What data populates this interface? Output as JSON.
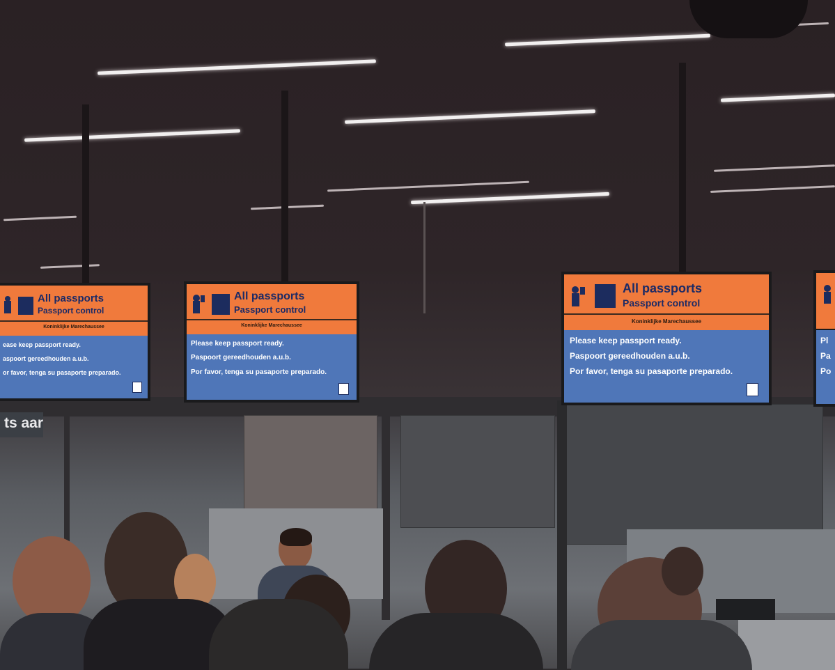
{
  "signs": [
    {
      "title": "All passports",
      "subtitle": "Passport control",
      "authority": "Koninklijke Marechaussee",
      "lines": [
        "ease keep passport ready.",
        "aspoort gereedhouden a.u.b.",
        "or favor, tenga su pasaporte preparado."
      ]
    },
    {
      "title": "All passports",
      "subtitle": "Passport control",
      "authority": "Koninklijke Marechaussee",
      "lines": [
        "Please keep passport ready.",
        "Paspoort gereedhouden a.u.b.",
        "Por favor, tenga su pasaporte preparado."
      ]
    },
    {
      "title": "All passports",
      "subtitle": "Passport control",
      "authority": "Koninklijke Marechaussee",
      "lines": [
        "Please keep passport ready.",
        "Paspoort gereedhouden a.u.b.",
        "Por favor, tenga su pasaporte preparado."
      ]
    },
    {
      "lines": [
        "Pl",
        "Pa",
        "Po"
      ]
    }
  ],
  "wall_sign_text": "ts aar",
  "colors": {
    "sign_orange": "#f07a3c",
    "sign_blue": "#4f76b8",
    "ceiling": "#2a2124"
  },
  "icons": [
    "officer-icon",
    "passport-icon",
    "no-flash-photo-icon"
  ]
}
